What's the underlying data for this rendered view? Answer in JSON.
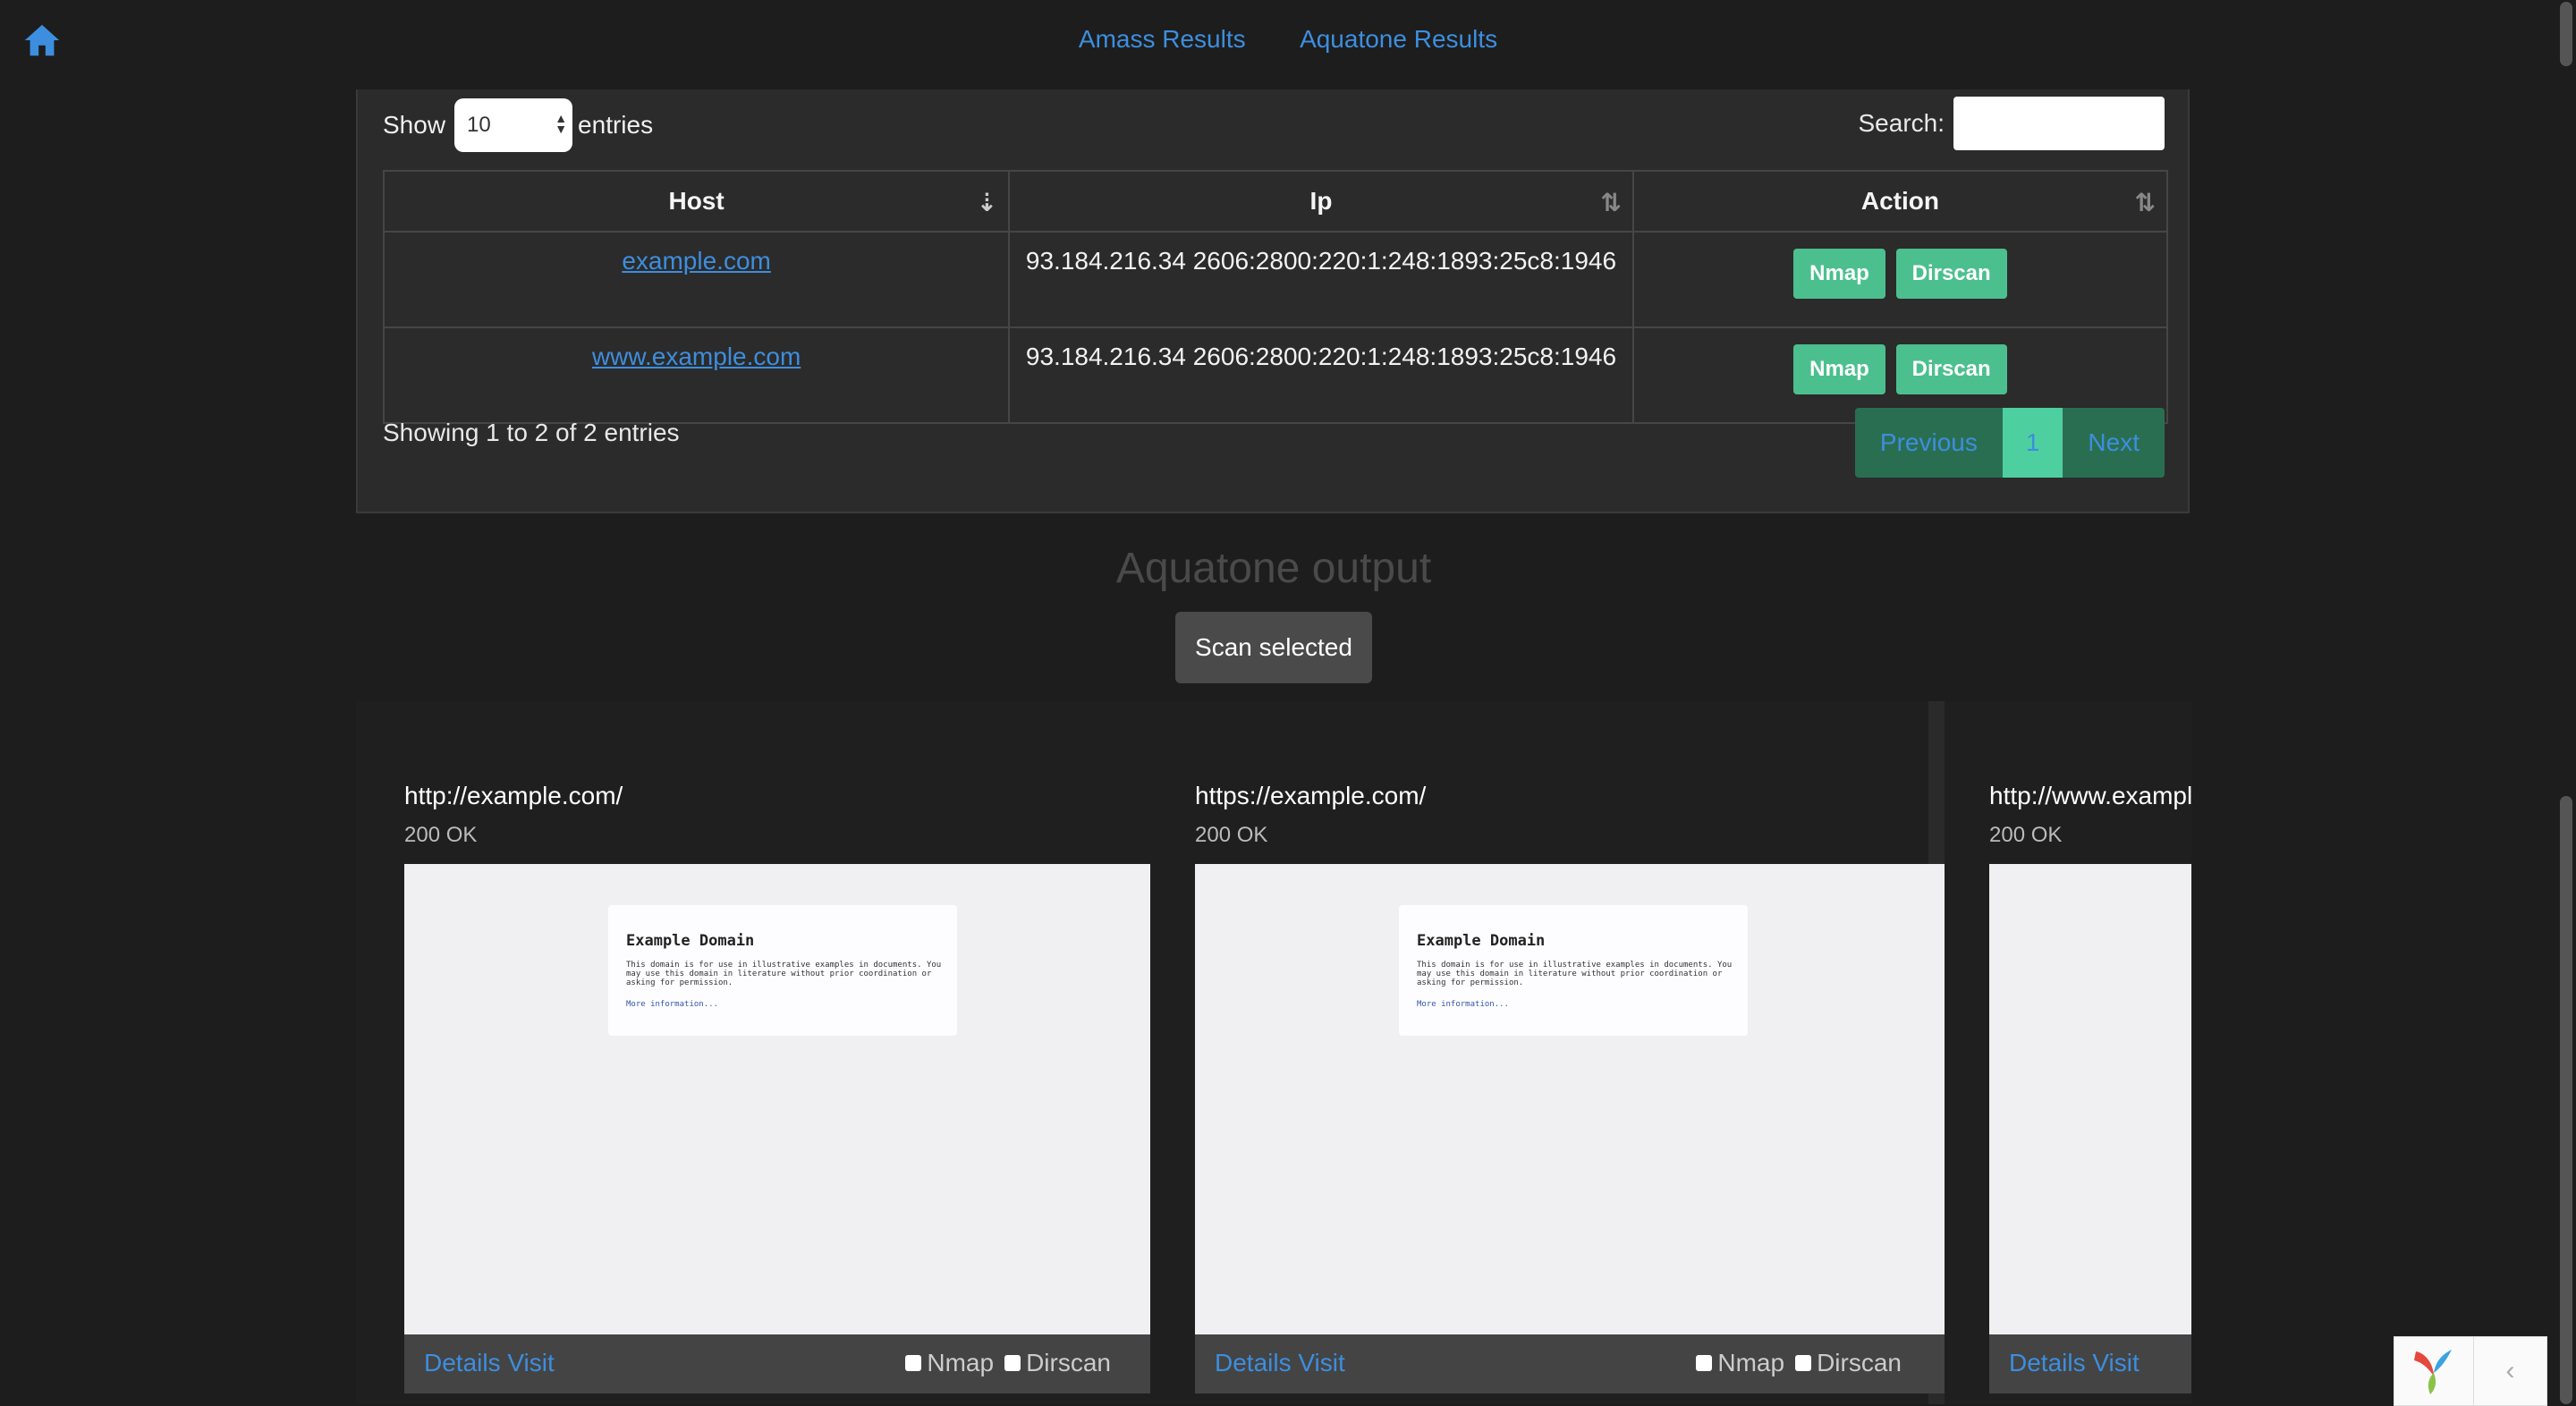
{
  "nav": {
    "links": [
      "Amass Results",
      "Aquatone Results"
    ]
  },
  "table_controls": {
    "show_label": "Show",
    "entries_value": "10",
    "entries_label": "entries",
    "search_label": "Search:",
    "search_value": ""
  },
  "table": {
    "headers": [
      "Host",
      "Ip",
      "Action"
    ],
    "rows": [
      {
        "host": "example.com",
        "ip": "93.184.216.34 2606:2800:220:1:248:1893:25c8:1946",
        "actions": [
          "Nmap",
          "Dirscan"
        ]
      },
      {
        "host": "www.example.com",
        "ip": "93.184.216.34 2606:2800:220:1:248:1893:25c8:1946",
        "actions": [
          "Nmap",
          "Dirscan"
        ]
      }
    ]
  },
  "footer": {
    "showing": "Showing 1 to 2 of 2 entries",
    "pagination": {
      "previous": "Previous",
      "current": "1",
      "next": "Next"
    }
  },
  "aquatone": {
    "title": "Aquatone output",
    "scan_button": "Scan selected",
    "cards": [
      {
        "url": "http://example.com/",
        "status": "200 OK",
        "details": "Details",
        "visit": "Visit",
        "nmap": "Nmap",
        "dirscan": "Dirscan",
        "preview": {
          "heading": "Example Domain",
          "text": "This domain is for use in illustrative examples in documents. You may use this domain in literature without prior coordination or asking for permission.",
          "link": "More information..."
        }
      },
      {
        "url": "https://example.com/",
        "status": "200 OK",
        "details": "Details",
        "visit": "Visit",
        "nmap": "Nmap",
        "dirscan": "Dirscan",
        "preview": {
          "heading": "Example Domain",
          "text": "This domain is for use in illustrative examples in documents. You may use this domain in literature without prior coordination or asking for permission.",
          "link": "More information..."
        }
      },
      {
        "url": "http://www.exampl",
        "status": "200 OK",
        "details": "Details",
        "visit": "Visit"
      }
    ]
  },
  "colors": {
    "link": "#3d8ede",
    "action_button": "#4cbf8e",
    "background": "#1d1d1d"
  }
}
